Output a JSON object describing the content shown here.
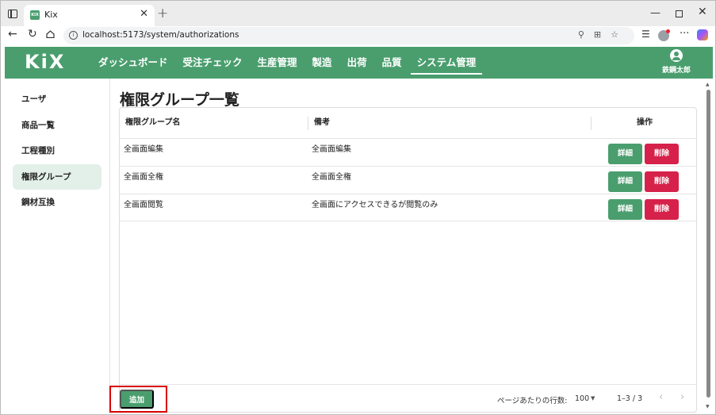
{
  "browser": {
    "tab_title": "Kix",
    "favicon_text": "KIX",
    "url": "localhost:5173/system/authorizations",
    "window_min": "—",
    "window_close": "✕",
    "new_tab": "+"
  },
  "header": {
    "logo": "KiX",
    "nav": [
      "ダッシュボード",
      "受注チェック",
      "生産管理",
      "製造",
      "出荷",
      "品質",
      "システム管理"
    ],
    "active_nav": "システム管理",
    "user_name": "鉄鋼太郎"
  },
  "sidebar": {
    "items": [
      {
        "label": "ユーザ",
        "active": false
      },
      {
        "label": "商品一覧",
        "active": false
      },
      {
        "label": "工程種別",
        "active": false
      },
      {
        "label": "権限グループ",
        "active": true
      },
      {
        "label": "鋼材互換",
        "active": false
      }
    ]
  },
  "page": {
    "title": "権限グループ一覧",
    "columns": {
      "name": "権限グループ名",
      "note": "備考",
      "actions": "操作"
    },
    "rows": [
      {
        "name": "全画面編集",
        "note": "全画面編集"
      },
      {
        "name": "全画面全権",
        "note": "全画面全権"
      },
      {
        "name": "全画面閲覧",
        "note": "全画面にアクセスできるが閲覧のみ"
      }
    ],
    "detail_label": "詳細",
    "delete_label": "削除",
    "add_label": "追加",
    "pagination": {
      "rows_per_page_label": "ページあたりの行数:",
      "rows_per_page": "100",
      "range": "1–3 / 3"
    }
  },
  "colors": {
    "brand": "#4a9e6e",
    "danger": "#d6224a",
    "highlight": "#d90000"
  }
}
